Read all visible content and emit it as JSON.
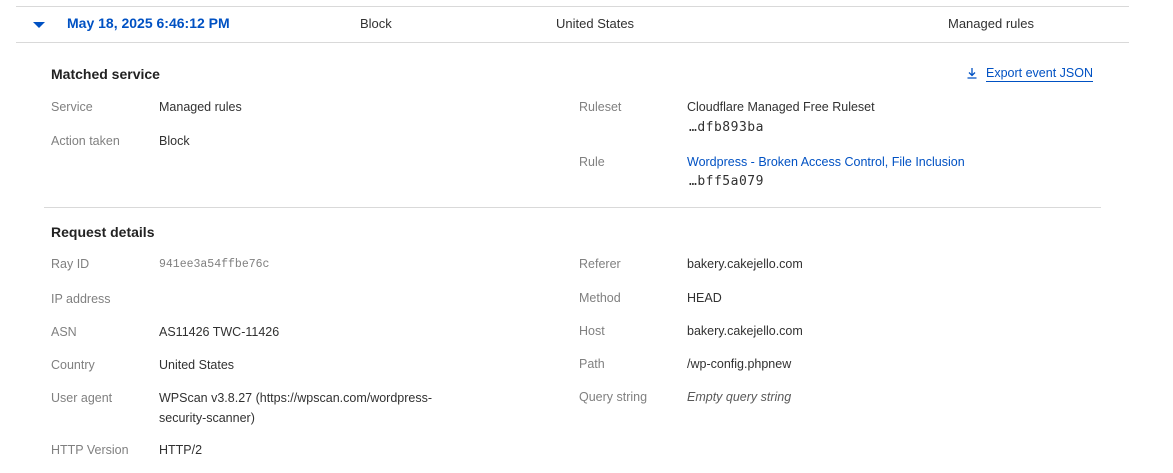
{
  "event": {
    "timestamp": "May 18, 2025 6:46:12 PM",
    "action": "Block",
    "country": "United States",
    "service": "Managed rules"
  },
  "matched_service": {
    "title": "Matched service",
    "export_label": "Export event JSON",
    "service_label": "Service",
    "service_value": "Managed rules",
    "action_label": "Action taken",
    "action_value": "Block",
    "ruleset_label": "Ruleset",
    "ruleset_name": "Cloudflare Managed Free Ruleset",
    "ruleset_id": "…dfb893ba",
    "rule_label": "Rule",
    "rule_name": "Wordpress - Broken Access Control, File Inclusion",
    "rule_id": "…bff5a079"
  },
  "request_details": {
    "title": "Request details",
    "ray_id_label": "Ray ID",
    "ray_id_value": "941ee3a54ffbe76c",
    "ip_label": "IP address",
    "ip_value": "",
    "asn_label": "ASN",
    "asn_value": "AS11426 TWC-11426",
    "country_label": "Country",
    "country_value": "United States",
    "user_agent_label": "User agent",
    "user_agent_line1": "WPScan v3.8.27 (https://wpscan.com/wordpress-",
    "user_agent_line2": "security-scanner)",
    "http_version_label": "HTTP Version",
    "http_version_value": "HTTP/2",
    "referer_label": "Referer",
    "referer_value": "bakery.cakejello.com",
    "method_label": "Method",
    "method_value": "HEAD",
    "host_label": "Host",
    "host_value": "bakery.cakejello.com",
    "path_label": "Path",
    "path_value": "/wp-config.phpnew",
    "query_label": "Query string",
    "query_value": "Empty query string"
  },
  "icons": {
    "collapse": "chevron-down-icon",
    "export": "download-icon"
  },
  "colors": {
    "accent": "#0051c3",
    "label": "#808080",
    "text": "#313131",
    "divider": "#d9d9d9"
  }
}
